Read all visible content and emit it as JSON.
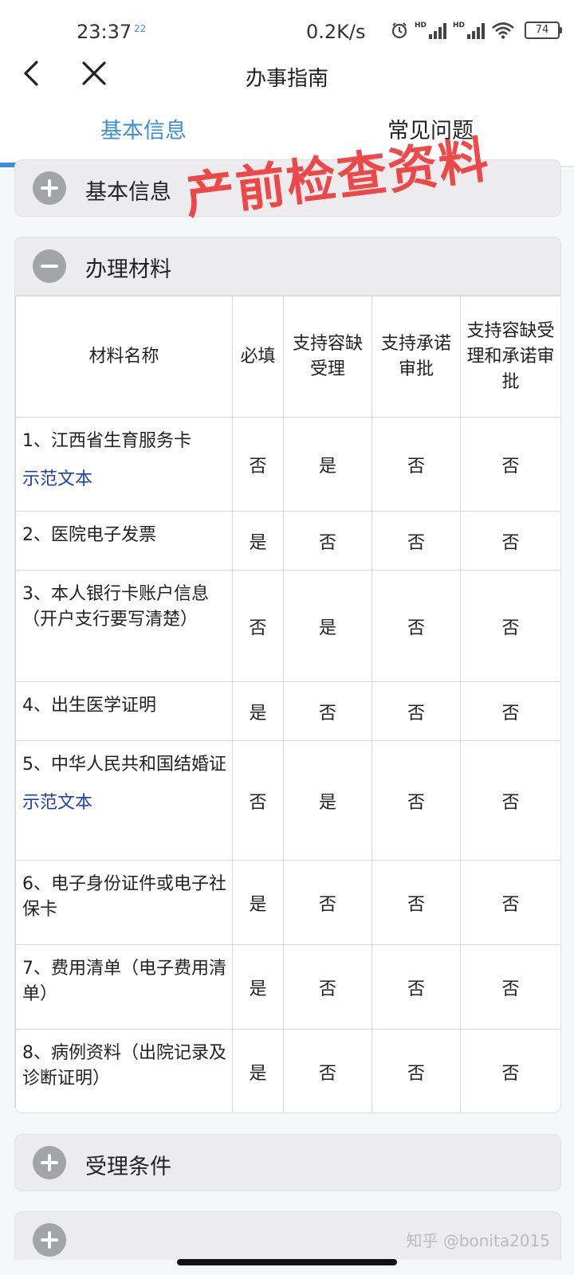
{
  "status_bar": {
    "time": "23:37",
    "mini_badge": "22",
    "network_speed": "0.2K/s",
    "signal_label": "HD",
    "battery": "74"
  },
  "nav": {
    "title": "办事指南"
  },
  "tabs": [
    {
      "label": "基本信息",
      "active": true
    },
    {
      "label": "常见问题",
      "active": false
    }
  ],
  "sections": {
    "basic_info": {
      "label": "基本信息",
      "expanded": false
    },
    "materials": {
      "label": "办理材料",
      "expanded": true
    },
    "conditions": {
      "label": "受理条件",
      "expanded": false
    }
  },
  "stamp_text": "产前检查资料",
  "table": {
    "headers": [
      "材料名称",
      "必填",
      "支持容缺受理",
      "支持承诺审批",
      "支持容缺受理和承诺审批"
    ],
    "rows": [
      {
        "name": "1、江西省生育服务卡",
        "link": "示范文本",
        "required": "否",
        "accept_missing": "是",
        "commit_approval": "否",
        "both": "否"
      },
      {
        "name": "2、医院电子发票",
        "link": "",
        "required": "是",
        "accept_missing": "否",
        "commit_approval": "否",
        "both": "否"
      },
      {
        "name": "3、本人银行卡账户信息（开户支行要写清楚）",
        "link": "",
        "required": "否",
        "accept_missing": "是",
        "commit_approval": "否",
        "both": "否"
      },
      {
        "name": "4、出生医学证明",
        "link": "",
        "required": "是",
        "accept_missing": "否",
        "commit_approval": "否",
        "both": "否"
      },
      {
        "name": "5、中华人民共和国结婚证",
        "link": "示范文本",
        "required": "否",
        "accept_missing": "是",
        "commit_approval": "否",
        "both": "否"
      },
      {
        "name": "6、电子身份证件或电子社保卡",
        "link": "",
        "required": "是",
        "accept_missing": "否",
        "commit_approval": "否",
        "both": "否"
      },
      {
        "name": "7、费用清单（电子费用清单）",
        "link": "",
        "required": "是",
        "accept_missing": "否",
        "commit_approval": "否",
        "both": "否"
      },
      {
        "name": "8、病例资料（出院记录及诊断证明）",
        "link": "",
        "required": "是",
        "accept_missing": "否",
        "commit_approval": "否",
        "both": "否"
      }
    ]
  },
  "watermark": "知乎 @bonita2015",
  "colors": {
    "accent": "#3a8fd6",
    "stamp": "#ee3a3a",
    "link": "#1f3fb5"
  }
}
